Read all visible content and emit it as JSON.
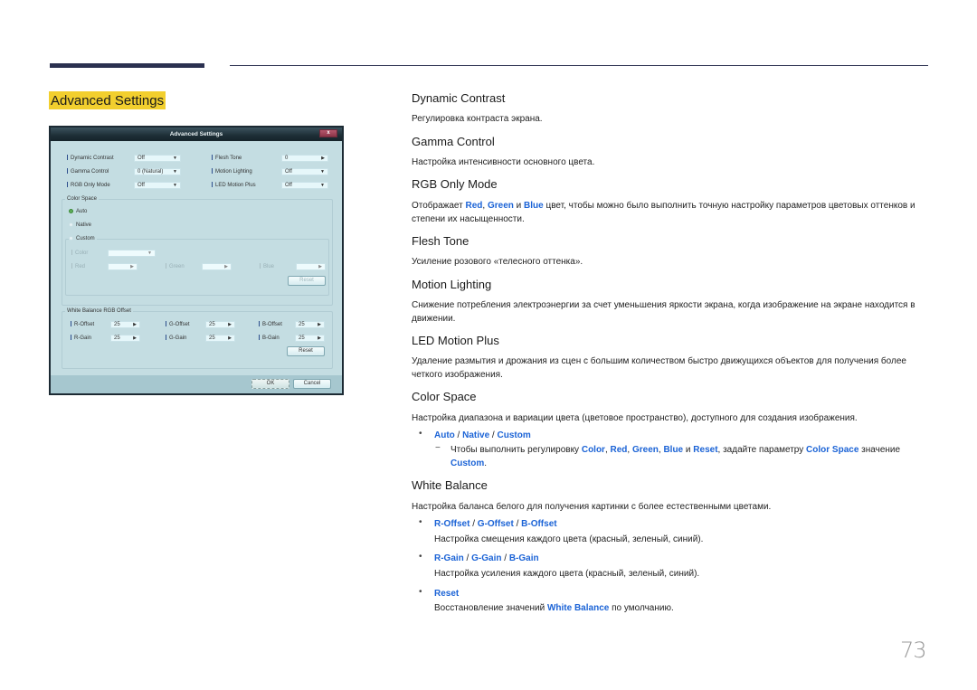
{
  "page": {
    "section_title": "Advanced Settings",
    "page_number": "73"
  },
  "dialog": {
    "title": "Advanced Settings",
    "close_label": "x",
    "rows_left": [
      {
        "label": "Dynamic Contrast",
        "value": "Off"
      },
      {
        "label": "Gamma Control",
        "value": "0 (Natural)"
      },
      {
        "label": "RGB Only Mode",
        "value": "Off"
      }
    ],
    "rows_right": [
      {
        "label": "Flesh Tone",
        "value": "0"
      },
      {
        "label": "Motion Lighting",
        "value": "Off"
      },
      {
        "label": "LED Motion Plus",
        "value": "Off"
      }
    ],
    "color_space": {
      "title": "Color Space",
      "options": [
        {
          "label": "Auto",
          "selected": true
        },
        {
          "label": "Native",
          "selected": false
        },
        {
          "label": "Custom",
          "selected": false
        }
      ],
      "color_label": "Color",
      "color_value": "",
      "red_label": "Red",
      "green_label": "Green",
      "blue_label": "Blue",
      "red_value": "",
      "green_value": "",
      "blue_value": "",
      "reset_label": "Reset"
    },
    "white_balance": {
      "title": "White Balance RGB Offset",
      "items": [
        {
          "label": "R-Offset",
          "value": "25"
        },
        {
          "label": "G-Offset",
          "value": "25"
        },
        {
          "label": "B-Offset",
          "value": "25"
        },
        {
          "label": "R-Gain",
          "value": "25"
        },
        {
          "label": "G-Gain",
          "value": "25"
        },
        {
          "label": "B-Gain",
          "value": "25"
        }
      ],
      "reset_label": "Reset"
    },
    "ok_label": "OK",
    "cancel_label": "Cancel",
    "arrow_down": "▼",
    "arrow_right": "▶"
  },
  "content": {
    "dynamic_contrast": {
      "heading": "Dynamic Contrast",
      "text": "Регулировка контраста экрана."
    },
    "gamma_control": {
      "heading": "Gamma Control",
      "text": "Настройка интенсивности основного цвета."
    },
    "rgb_only_mode": {
      "heading": "RGB Only Mode",
      "text_1": "Отображает ",
      "red": "Red",
      "comma": ", ",
      "green": "Green",
      "and": " и ",
      "blue": "Blue",
      "text_2": " цвет, чтобы можно было выполнить точную настройку параметров цветовых оттенков и степени их насыщенности."
    },
    "flesh_tone": {
      "heading": "Flesh Tone",
      "text": "Усиление розового «телесного оттенка»."
    },
    "motion_lighting": {
      "heading": "Motion Lighting",
      "text": "Снижение потребления электроэнергии за счет уменьшения яркости экрана, когда изображение на экране находится в движении."
    },
    "led_motion_plus": {
      "heading": "LED Motion Plus",
      "text": "Удаление размытия и дрожания из сцен с большим количеством быстро движущихся объектов для получения более четкого изображения."
    },
    "color_space": {
      "heading": "Color Space",
      "text": "Настройка диапазона и вариации цвета (цветовое пространство), доступного для создания изображения.",
      "bullet": "•",
      "opt_auto": "Auto",
      "opt_native": "Native",
      "opt_custom": "Custom",
      "slash": " / ",
      "dash": "−",
      "note_1": "Чтобы выполнить регулировку ",
      "note_color": "Color",
      "note_red": "Red",
      "note_green": "Green",
      "note_blue": "Blue",
      "note_reset": "Reset",
      "note_comma": ", ",
      "note_and": " и ",
      "note_2": ", задайте параметру ",
      "note_color_space": "Color Space",
      "note_3": " значение ",
      "note_custom": "Custom",
      "note_end": "."
    },
    "white_balance": {
      "heading": "White Balance",
      "text": "Настройка баланса белого для получения картинки с более естественными цветами.",
      "offset_r": "R-Offset",
      "offset_g": "G-Offset",
      "offset_b": "B-Offset",
      "offset_text": "Настройка смещения каждого цвета (красный, зеленый, синий).",
      "gain_r": "R-Gain",
      "gain_g": "G-Gain",
      "gain_b": "B-Gain",
      "gain_text": "Настройка усиления каждого цвета (красный, зеленый, синий).",
      "reset": "Reset",
      "reset_text_1": "Восстановление значений ",
      "reset_wb": "White Balance",
      "reset_text_2": " по умолчанию."
    }
  },
  "colors": {
    "highlight": "#f2cf2e",
    "link_blue": "#1b63d6",
    "header_bar": "#2b3150",
    "dialog_bg": "#c4dde2"
  }
}
